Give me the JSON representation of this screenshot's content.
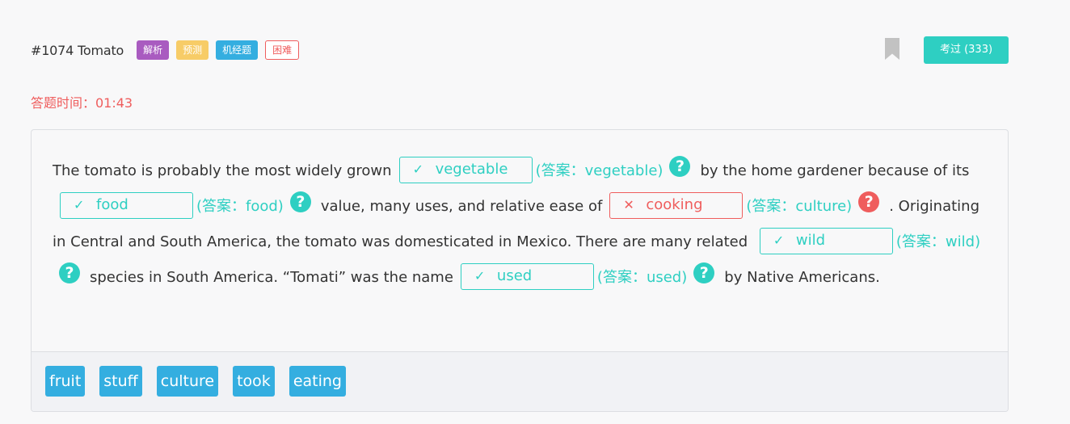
{
  "header": {
    "question_id": "#1074 Tomato",
    "tags": [
      "解析",
      "预测",
      "机经题",
      "困难"
    ],
    "pass_button": "考过 (333)"
  },
  "timer": "答题时间：01:43",
  "passage": {
    "text1": "The tomato is probably the most widely grown",
    "blank1": {
      "mark": "✓",
      "value": "vegetable",
      "answer": "(答案：vegetable)"
    },
    "text2": "by the home gardener because of its",
    "blank2": {
      "mark": "✓",
      "value": "food",
      "answer": "(答案：food)"
    },
    "text3": "value, many uses, and relative ease of",
    "blank3": {
      "mark": "✕",
      "value": "cooking",
      "answer": "(答案：culture)"
    },
    "text4": ". Originating in Central and South America, the tomato was domesticated in Mexico. There are many related",
    "blank4": {
      "mark": "✓",
      "value": "wild",
      "answer": "(答案：wild)"
    },
    "text5": "species in South America. “Tomati” was the name",
    "blank5": {
      "mark": "✓",
      "value": "used",
      "answer": "(答案：used)"
    },
    "text6": "by Native Americans.",
    "help_glyph": "?"
  },
  "options": [
    "fruit",
    "stuff",
    "culture",
    "took",
    "eating"
  ],
  "colors": {
    "correct": "#2ecfc2",
    "wrong": "#ef5d5d",
    "option": "#34aee0"
  },
  "icons": {
    "bookmark": "bookmark-icon",
    "help": "question-circle-icon"
  }
}
